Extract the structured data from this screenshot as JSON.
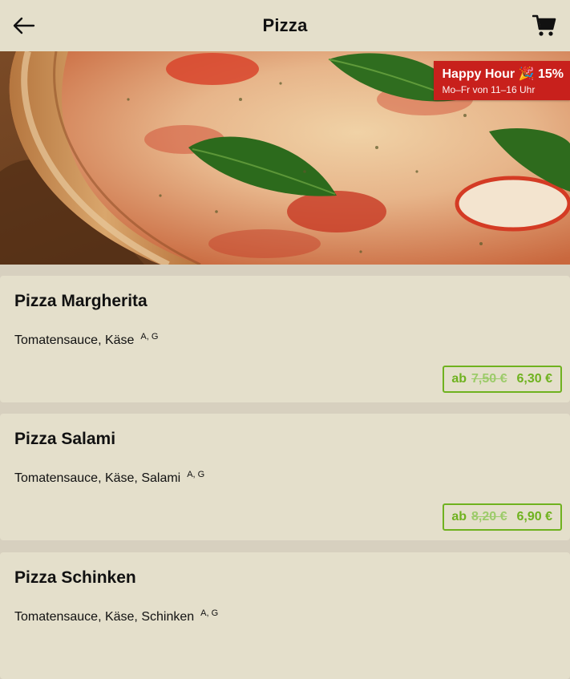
{
  "header": {
    "title": "Pizza",
    "back_icon": "arrow-left-icon",
    "cart_icon": "shopping-cart-icon"
  },
  "promo": {
    "title": "Happy Hour 🎉 15%",
    "subtitle": "Mo–Fr von 11–16 Uhr",
    "color": "#c8201c"
  },
  "accent_color": "#6fb21f",
  "products": [
    {
      "name": "Pizza Margherita",
      "description": "Tomatensauce, Käse",
      "allergens": "A, G",
      "price_prefix": "ab",
      "old_price": "7,50 €",
      "price": "6,30 €"
    },
    {
      "name": "Pizza Salami",
      "description": "Tomatensauce, Käse, Salami",
      "allergens": "A, G",
      "price_prefix": "ab",
      "old_price": "8,20 €",
      "price": "6,90 €"
    },
    {
      "name": "Pizza Schinken",
      "description": "Tomatensauce, Käse, Schinken",
      "allergens": "A, G"
    }
  ]
}
